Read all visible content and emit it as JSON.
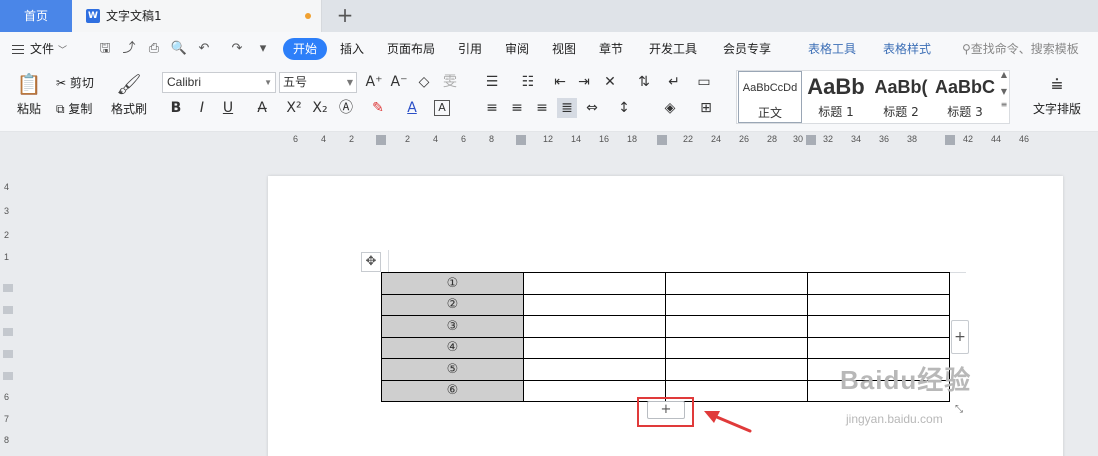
{
  "tabs": {
    "home_label": "首页",
    "document_title": "文字文稿1",
    "add_symbol": "+"
  },
  "menubar": {
    "file_label": "文件",
    "tabs": [
      {
        "label": "开始",
        "active": true
      },
      {
        "label": "插入"
      },
      {
        "label": "页面布局"
      },
      {
        "label": "引用"
      },
      {
        "label": "审阅"
      },
      {
        "label": "视图"
      },
      {
        "label": "章节"
      },
      {
        "label": "开发工具"
      },
      {
        "label": "会员专享"
      },
      {
        "label": "表格工具",
        "context": true
      },
      {
        "label": "表格样式",
        "context": true
      }
    ],
    "search_placeholder": "查找命令、搜索模板"
  },
  "ribbon": {
    "paste_label": "粘贴",
    "cut_label": "剪切",
    "copy_label": "复制",
    "format_painter_label": "格式刷",
    "font_name": "Calibri",
    "font_size": "五号",
    "styles": [
      {
        "sample": "AaBbCcDd",
        "name": "正文"
      },
      {
        "sample": "AaBb",
        "name": "标题 1"
      },
      {
        "sample": "AaBb(",
        "name": "标题 2"
      },
      {
        "sample": "AaBbC",
        "name": "标题 3"
      }
    ],
    "text_layout_label": "文字排版"
  },
  "ruler": {
    "numbers": [
      "6",
      "4",
      "2",
      "2",
      "4",
      "6",
      "8",
      "12",
      "14",
      "16",
      "18",
      "22",
      "24",
      "26",
      "28",
      "30",
      "32",
      "34",
      "36",
      "38",
      "42",
      "44",
      "46"
    ],
    "vertical_numbers": [
      "4",
      "3",
      "2",
      "1",
      "6",
      "7",
      "8"
    ]
  },
  "table": {
    "rows": [
      {
        "label": "①"
      },
      {
        "label": "②"
      },
      {
        "label": "③"
      },
      {
        "label": "④"
      },
      {
        "label": "⑤"
      },
      {
        "label": "⑥"
      }
    ],
    "add_row_symbol": "+",
    "add_column_symbol": "+"
  },
  "watermark": {
    "text": "Baidu经验",
    "subtext": "jingyan.baidu.com"
  },
  "colors": {
    "accent": "#2d7ff9",
    "home_tab": "#4a86e8",
    "highlight_box": "#e03a3a",
    "header_cell": "#cfcfcf"
  }
}
